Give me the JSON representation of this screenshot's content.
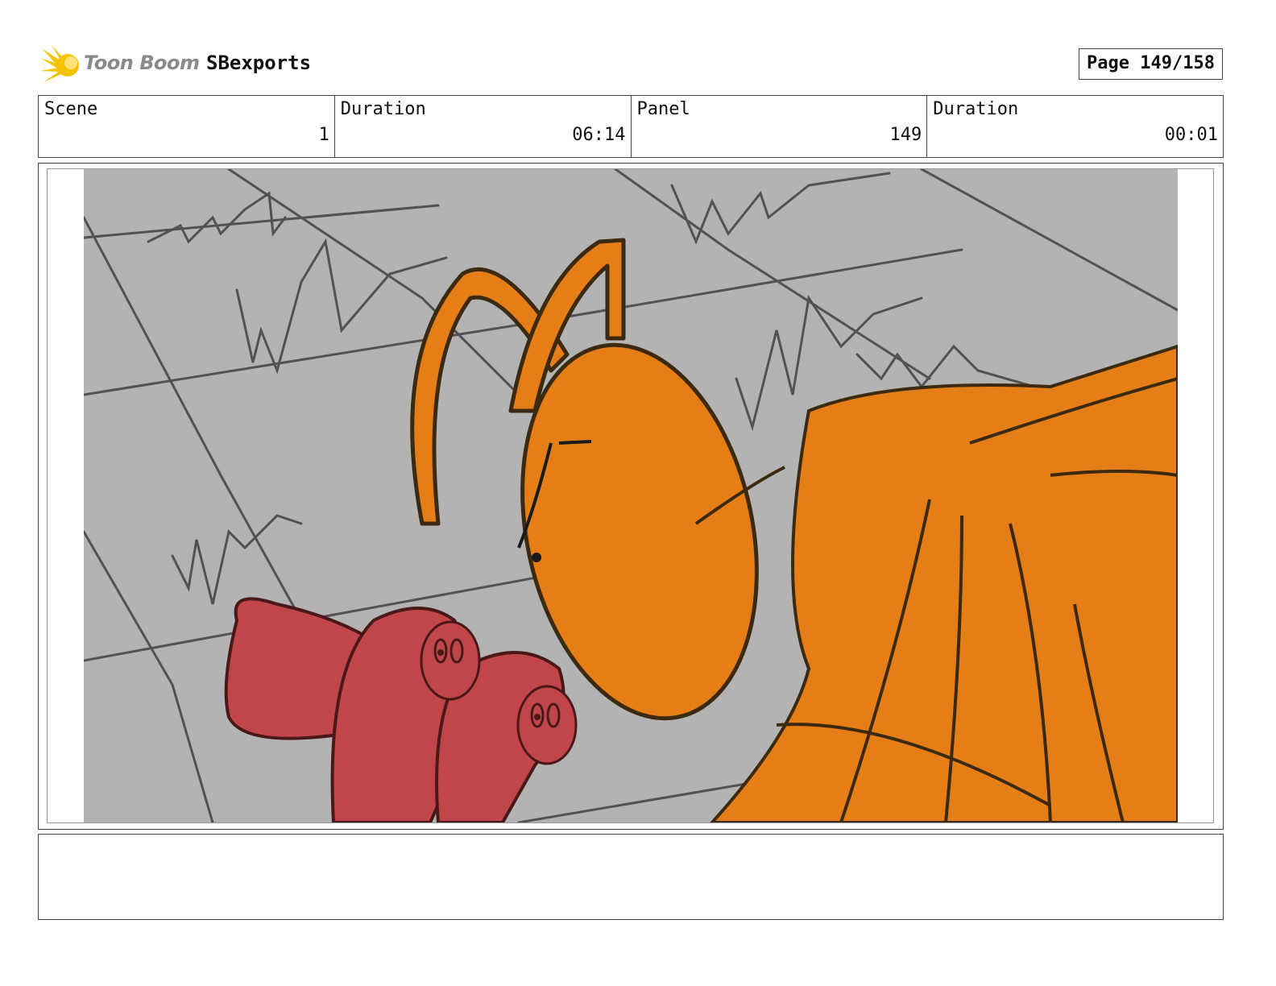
{
  "header": {
    "logo_text": "Toon Boom",
    "project_name": "SBexports",
    "page_label": "Page 149/158"
  },
  "info": {
    "scene_label": "Scene",
    "scene_value": "1",
    "scene_duration_label": "Duration",
    "scene_duration_value": "06:14",
    "panel_label": "Panel",
    "panel_value": "149",
    "panel_duration_label": "Duration",
    "panel_duration_value": "00:01"
  },
  "colors": {
    "logo_yellow": "#f5c400",
    "background_gray": "#b3b3b3",
    "character_orange": "#e67e17",
    "character_red": "#c0464a",
    "sketch_line": "#3a3a3a"
  },
  "notes": {
    "caption": ""
  }
}
